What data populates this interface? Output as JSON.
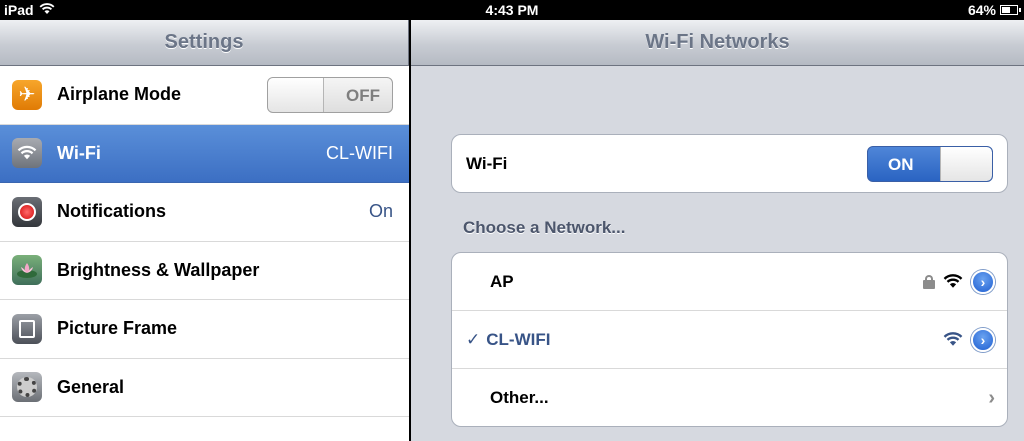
{
  "status_bar": {
    "carrier": "iPad",
    "time": "4:43 PM",
    "battery": "64%",
    "battery_level": 0.64
  },
  "settings": {
    "title": "Settings",
    "items": [
      {
        "label": "Airplane Mode",
        "value": "OFF",
        "icon": "airplane-icon"
      },
      {
        "label": "Wi-Fi",
        "value": "CL-WIFI",
        "icon": "wifi-icon",
        "selected": true
      },
      {
        "label": "Notifications",
        "value": "On",
        "icon": "notifications-icon"
      },
      {
        "label": "Brightness & Wallpaper",
        "value": "",
        "icon": "brightness-icon"
      },
      {
        "label": "Picture Frame",
        "value": "",
        "icon": "picture-frame-icon"
      },
      {
        "label": "General",
        "value": "",
        "icon": "gear-icon"
      }
    ]
  },
  "wifi_networks": {
    "title": "Wi-Fi Networks",
    "wifi_label": "Wi-Fi",
    "wifi_toggle": "ON",
    "choose_label": "Choose a Network...",
    "networks": [
      {
        "name": "AP",
        "secured": true,
        "joined": false
      },
      {
        "name": "CL-WIFI",
        "secured": false,
        "joined": true
      }
    ],
    "other_label": "Other...",
    "check_mark": "✓"
  },
  "colors": {
    "selected_row": "#3c6fc3",
    "accent_blue": "#385487",
    "toggle_on": "#2a64c2"
  }
}
